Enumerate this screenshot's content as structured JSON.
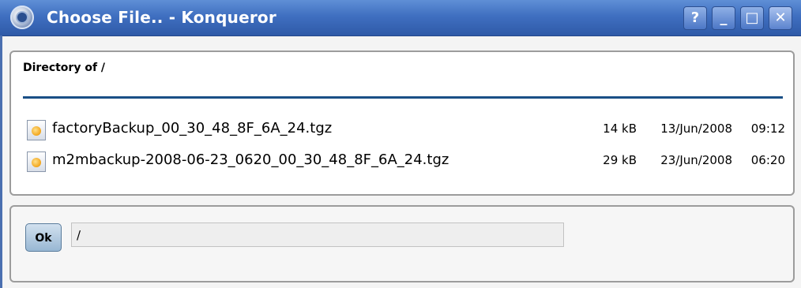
{
  "window": {
    "title": "Choose File.. - Konqueror",
    "buttons": {
      "help": "?",
      "minimize": "_",
      "maximize": "□",
      "close": "✕"
    }
  },
  "listing": {
    "heading": "Directory of /",
    "files": [
      {
        "name": "factoryBackup_00_30_48_8F_6A_24.tgz",
        "size": "14 kB",
        "date": "13/Jun/2008",
        "time": "09:12"
      },
      {
        "name": "m2mbackup-2008-06-23_0620_00_30_48_8F_6A_24.tgz",
        "size": "29 kB",
        "date": "23/Jun/2008",
        "time": "06:20"
      }
    ]
  },
  "form": {
    "ok_label": "Ok",
    "path_value": "/"
  },
  "colors": {
    "titlebar": "#3f6fc0",
    "rule": "#1a4f86"
  },
  "icons": {
    "app": "konqueror-globe-icon",
    "file": "tgz-archive-icon"
  }
}
